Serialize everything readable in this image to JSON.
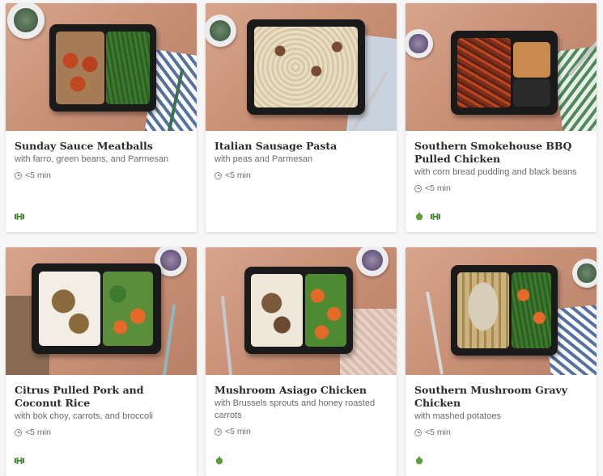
{
  "meals": [
    {
      "title": "Sunday Sauce Meatballs",
      "subtitle": "with farro, green beans, and Parmesan",
      "time": "<5 min",
      "badges": [
        "protein-icon"
      ]
    },
    {
      "title": "Italian Sausage Pasta",
      "subtitle": "with peas and Parmesan",
      "time": "<5 min",
      "badges": []
    },
    {
      "title": "Southern Smokehouse BBQ Pulled Chicken",
      "subtitle": "with corn bread pudding and black beans",
      "time": "<5 min",
      "badges": [
        "apple-icon",
        "protein-icon"
      ]
    },
    {
      "title": "Citrus Pulled Pork and Coconut Rice",
      "subtitle": "with bok choy, carrots, and broccoli",
      "time": "<5 min",
      "badges": [
        "protein-icon"
      ]
    },
    {
      "title": "Mushroom Asiago Chicken",
      "subtitle": "with Brussels sprouts and honey roasted carrots",
      "time": "<5 min",
      "badges": [
        "apple-icon"
      ]
    },
    {
      "title": "Southern Mushroom Gravy Chicken",
      "subtitle": "with mashed potatoes",
      "time": "<5 min",
      "badges": [
        "apple-icon"
      ]
    }
  ],
  "colors": {
    "protein": "#4a8a3c",
    "apple": "#5a9e3a",
    "text": "#2b2b2b",
    "muted": "#6b6b6b"
  }
}
